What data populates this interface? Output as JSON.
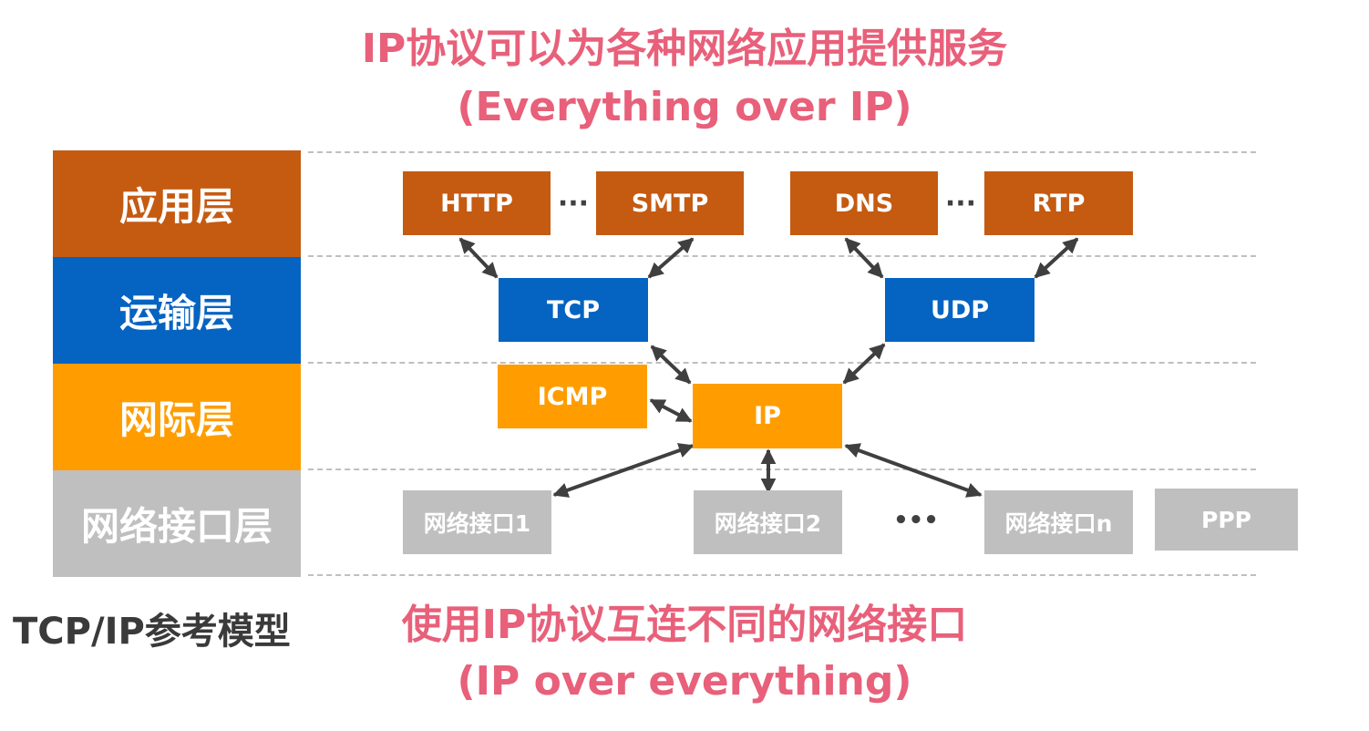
{
  "header": {
    "title_line1": "IP协议可以为各种网络应用提供服务",
    "title_line2": "(Everything over IP)"
  },
  "footer": {
    "title_line1": "使用IP协议互连不同的网络接口",
    "title_line2": "(IP over everything)"
  },
  "model": {
    "caption": "TCP/IP参考模型",
    "layers": [
      {
        "label": "应用层",
        "color": "#c55a11"
      },
      {
        "label": "运输层",
        "color": "#0563c1"
      },
      {
        "label": "网际层",
        "color": "#ff9d00"
      },
      {
        "label": "网络接口层",
        "color": "#bfbfbf"
      }
    ]
  },
  "protocols": {
    "application": [
      "HTTP",
      "SMTP",
      "DNS",
      "RTP"
    ],
    "transport": [
      "TCP",
      "UDP"
    ],
    "internet": [
      "ICMP",
      "IP"
    ],
    "interfaces": [
      "网络接口1",
      "网络接口2",
      "网络接口n",
      "PPP"
    ]
  },
  "ellipsis": {
    "small": "···",
    "large": "•••"
  },
  "colors": {
    "title": "#e8607a",
    "arrow": "#3f3f3f",
    "separator": "#bfbfbf"
  }
}
